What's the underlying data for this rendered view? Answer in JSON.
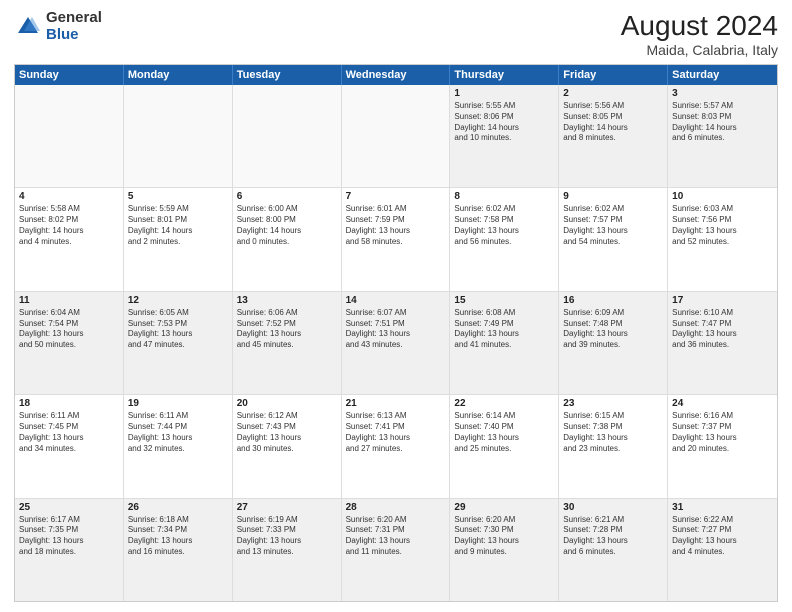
{
  "logo": {
    "general": "General",
    "blue": "Blue"
  },
  "header": {
    "month_year": "August 2024",
    "location": "Maida, Calabria, Italy"
  },
  "days_of_week": [
    "Sunday",
    "Monday",
    "Tuesday",
    "Wednesday",
    "Thursday",
    "Friday",
    "Saturday"
  ],
  "weeks": [
    [
      {
        "day": "",
        "empty": true,
        "lines": []
      },
      {
        "day": "",
        "empty": true,
        "lines": []
      },
      {
        "day": "",
        "empty": true,
        "lines": []
      },
      {
        "day": "",
        "empty": true,
        "lines": []
      },
      {
        "day": "1",
        "lines": [
          "Sunrise: 5:55 AM",
          "Sunset: 8:06 PM",
          "Daylight: 14 hours",
          "and 10 minutes."
        ]
      },
      {
        "day": "2",
        "lines": [
          "Sunrise: 5:56 AM",
          "Sunset: 8:05 PM",
          "Daylight: 14 hours",
          "and 8 minutes."
        ]
      },
      {
        "day": "3",
        "lines": [
          "Sunrise: 5:57 AM",
          "Sunset: 8:03 PM",
          "Daylight: 14 hours",
          "and 6 minutes."
        ]
      }
    ],
    [
      {
        "day": "4",
        "lines": [
          "Sunrise: 5:58 AM",
          "Sunset: 8:02 PM",
          "Daylight: 14 hours",
          "and 4 minutes."
        ]
      },
      {
        "day": "5",
        "lines": [
          "Sunrise: 5:59 AM",
          "Sunset: 8:01 PM",
          "Daylight: 14 hours",
          "and 2 minutes."
        ]
      },
      {
        "day": "6",
        "lines": [
          "Sunrise: 6:00 AM",
          "Sunset: 8:00 PM",
          "Daylight: 14 hours",
          "and 0 minutes."
        ]
      },
      {
        "day": "7",
        "lines": [
          "Sunrise: 6:01 AM",
          "Sunset: 7:59 PM",
          "Daylight: 13 hours",
          "and 58 minutes."
        ]
      },
      {
        "day": "8",
        "lines": [
          "Sunrise: 6:02 AM",
          "Sunset: 7:58 PM",
          "Daylight: 13 hours",
          "and 56 minutes."
        ]
      },
      {
        "day": "9",
        "lines": [
          "Sunrise: 6:02 AM",
          "Sunset: 7:57 PM",
          "Daylight: 13 hours",
          "and 54 minutes."
        ]
      },
      {
        "day": "10",
        "lines": [
          "Sunrise: 6:03 AM",
          "Sunset: 7:56 PM",
          "Daylight: 13 hours",
          "and 52 minutes."
        ]
      }
    ],
    [
      {
        "day": "11",
        "lines": [
          "Sunrise: 6:04 AM",
          "Sunset: 7:54 PM",
          "Daylight: 13 hours",
          "and 50 minutes."
        ]
      },
      {
        "day": "12",
        "lines": [
          "Sunrise: 6:05 AM",
          "Sunset: 7:53 PM",
          "Daylight: 13 hours",
          "and 47 minutes."
        ]
      },
      {
        "day": "13",
        "lines": [
          "Sunrise: 6:06 AM",
          "Sunset: 7:52 PM",
          "Daylight: 13 hours",
          "and 45 minutes."
        ]
      },
      {
        "day": "14",
        "lines": [
          "Sunrise: 6:07 AM",
          "Sunset: 7:51 PM",
          "Daylight: 13 hours",
          "and 43 minutes."
        ]
      },
      {
        "day": "15",
        "lines": [
          "Sunrise: 6:08 AM",
          "Sunset: 7:49 PM",
          "Daylight: 13 hours",
          "and 41 minutes."
        ]
      },
      {
        "day": "16",
        "lines": [
          "Sunrise: 6:09 AM",
          "Sunset: 7:48 PM",
          "Daylight: 13 hours",
          "and 39 minutes."
        ]
      },
      {
        "day": "17",
        "lines": [
          "Sunrise: 6:10 AM",
          "Sunset: 7:47 PM",
          "Daylight: 13 hours",
          "and 36 minutes."
        ]
      }
    ],
    [
      {
        "day": "18",
        "lines": [
          "Sunrise: 6:11 AM",
          "Sunset: 7:45 PM",
          "Daylight: 13 hours",
          "and 34 minutes."
        ]
      },
      {
        "day": "19",
        "lines": [
          "Sunrise: 6:11 AM",
          "Sunset: 7:44 PM",
          "Daylight: 13 hours",
          "and 32 minutes."
        ]
      },
      {
        "day": "20",
        "lines": [
          "Sunrise: 6:12 AM",
          "Sunset: 7:43 PM",
          "Daylight: 13 hours",
          "and 30 minutes."
        ]
      },
      {
        "day": "21",
        "lines": [
          "Sunrise: 6:13 AM",
          "Sunset: 7:41 PM",
          "Daylight: 13 hours",
          "and 27 minutes."
        ]
      },
      {
        "day": "22",
        "lines": [
          "Sunrise: 6:14 AM",
          "Sunset: 7:40 PM",
          "Daylight: 13 hours",
          "and 25 minutes."
        ]
      },
      {
        "day": "23",
        "lines": [
          "Sunrise: 6:15 AM",
          "Sunset: 7:38 PM",
          "Daylight: 13 hours",
          "and 23 minutes."
        ]
      },
      {
        "day": "24",
        "lines": [
          "Sunrise: 6:16 AM",
          "Sunset: 7:37 PM",
          "Daylight: 13 hours",
          "and 20 minutes."
        ]
      }
    ],
    [
      {
        "day": "25",
        "lines": [
          "Sunrise: 6:17 AM",
          "Sunset: 7:35 PM",
          "Daylight: 13 hours",
          "and 18 minutes."
        ]
      },
      {
        "day": "26",
        "lines": [
          "Sunrise: 6:18 AM",
          "Sunset: 7:34 PM",
          "Daylight: 13 hours",
          "and 16 minutes."
        ]
      },
      {
        "day": "27",
        "lines": [
          "Sunrise: 6:19 AM",
          "Sunset: 7:33 PM",
          "Daylight: 13 hours",
          "and 13 minutes."
        ]
      },
      {
        "day": "28",
        "lines": [
          "Sunrise: 6:20 AM",
          "Sunset: 7:31 PM",
          "Daylight: 13 hours",
          "and 11 minutes."
        ]
      },
      {
        "day": "29",
        "lines": [
          "Sunrise: 6:20 AM",
          "Sunset: 7:30 PM",
          "Daylight: 13 hours",
          "and 9 minutes."
        ]
      },
      {
        "day": "30",
        "lines": [
          "Sunrise: 6:21 AM",
          "Sunset: 7:28 PM",
          "Daylight: 13 hours",
          "and 6 minutes."
        ]
      },
      {
        "day": "31",
        "lines": [
          "Sunrise: 6:22 AM",
          "Sunset: 7:27 PM",
          "Daylight: 13 hours",
          "and 4 minutes."
        ]
      }
    ]
  ]
}
